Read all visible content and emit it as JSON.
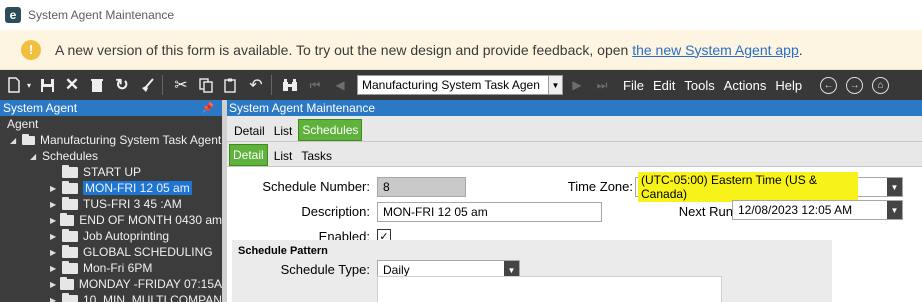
{
  "window": {
    "title": "System Agent Maintenance",
    "app_icon_letter": "e"
  },
  "banner": {
    "icon": "warning-icon",
    "message": "A new version of this form is available. To try out the new design and provide feedback, open ",
    "link_text": "the new System Agent app",
    "end_text": "."
  },
  "toolbar": {
    "nav_value": "Manufacturing System Task Agen",
    "menu": [
      "File",
      "Edit",
      "Tools",
      "Actions",
      "Help"
    ]
  },
  "left_panel": {
    "title": "System Agent",
    "pin": "░",
    "tree": {
      "root": "Agent",
      "agent": "Manufacturing System Task Agent",
      "schedules_label": "Schedules",
      "items": [
        "START UP",
        "MON-FRI 12 05 am",
        "TUS-FRI 3 45 :AM",
        "END OF MONTH 0430 am",
        "Job Autoprinting",
        "GLOBAL SCHEDULING",
        "Mon-Fri 6PM",
        "MONDAY -FRIDAY 07:15A",
        "10_MIN_MULTI COMPAN"
      ],
      "selected_index": 1
    }
  },
  "right_panel": {
    "title": "System Agent Maintenance",
    "tabs_top": [
      "Detail",
      "List",
      "Schedules"
    ],
    "tabs_top_active": 2,
    "tabs_sub": [
      "Detail",
      "List",
      "Tasks"
    ],
    "tabs_sub_active": 0
  },
  "form": {
    "schedule_number_label": "Schedule Number:",
    "schedule_number": "8",
    "description_label": "Description:",
    "description": "MON-FRI 12 05 am",
    "enabled_label": "Enabled:",
    "enabled": true,
    "enabled_mark": "✓",
    "time_zone_label": "Time Zone:",
    "time_zone": "(UTC-05:00) Eastern Time (US & Canada)",
    "next_run_label": "Next Run",
    "next_run": "12/08/2023 12:05 AM",
    "pattern_title": "Schedule Pattern",
    "schedule_type_label": "Schedule Type:",
    "schedule_type": "Daily"
  },
  "colors": {
    "accent": "#2b78c4",
    "active_tab": "#5fb23c",
    "highlight": "#f7f21a",
    "banner_bg": "#fdf5e1",
    "toolbar_bg": "#383838"
  }
}
